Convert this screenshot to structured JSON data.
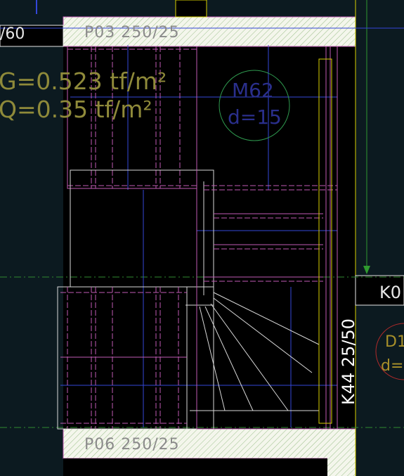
{
  "beams": {
    "top": "P03  250/25",
    "bottom": "P06  250/25"
  },
  "fragment_left": "/60",
  "loads": {
    "dead": "G=0.523 tf/m²",
    "live": "Q=0.35 tf/m²"
  },
  "slab": {
    "name": "M62",
    "thickness": "d=15"
  },
  "right_beam_fragment": "K0",
  "right_slab_fragment": {
    "name": "D1",
    "thickness": "d="
  },
  "column": "K44  25/50",
  "colors": {
    "background": "#0c1a20",
    "hatch": "#e7eee0",
    "magenta": "#c05ab4",
    "blue_axis": "#3347d8",
    "green_grid": "#2f8a2f",
    "yellow": "#d8d000"
  }
}
